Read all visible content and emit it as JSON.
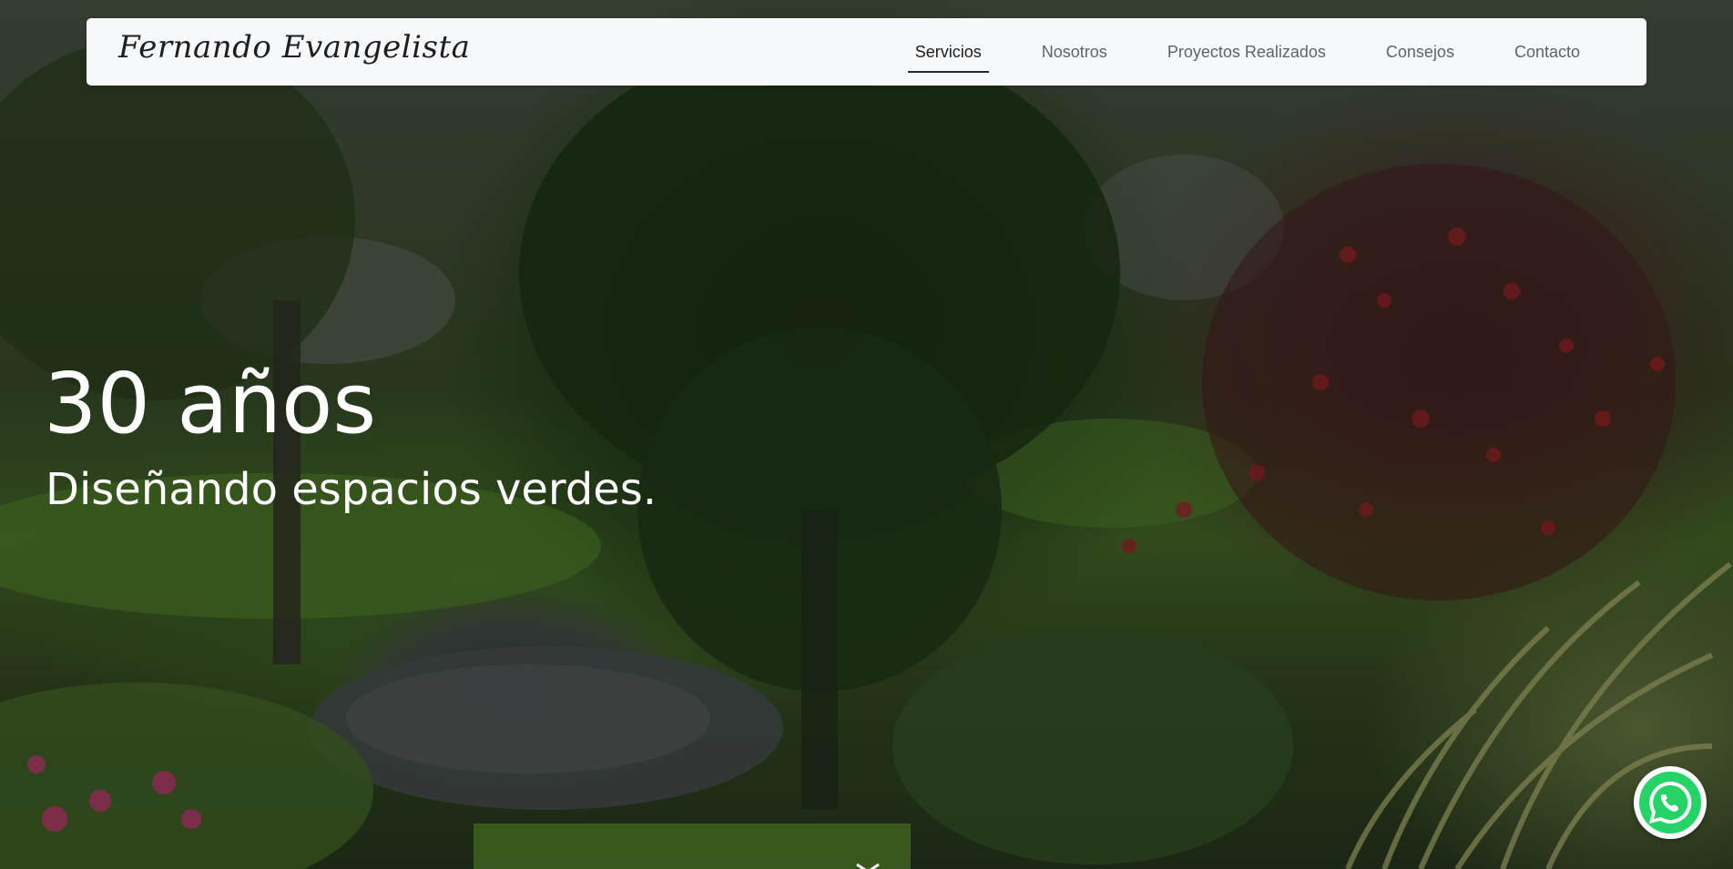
{
  "brand": {
    "name": "Fernando Evangelista"
  },
  "nav": {
    "items": [
      {
        "label": "Servicios",
        "active": true
      },
      {
        "label": "Nosotros",
        "active": false
      },
      {
        "label": "Proyectos Realizados",
        "active": false
      },
      {
        "label": "Consejos",
        "active": false
      },
      {
        "label": "Contacto",
        "active": false
      }
    ]
  },
  "hero": {
    "title": "30 años",
    "subtitle": "Diseñando espacios verdes."
  },
  "icons": {
    "whatsapp": "whatsapp-icon",
    "scroll": "chevron-down-icon"
  },
  "colors": {
    "navbar_bg": "#f7f8fa",
    "nav_active": "#1c1c1c",
    "nav_inactive": "#5f6368",
    "hero_text": "#ffffff",
    "whatsapp_green": "#25d366"
  }
}
